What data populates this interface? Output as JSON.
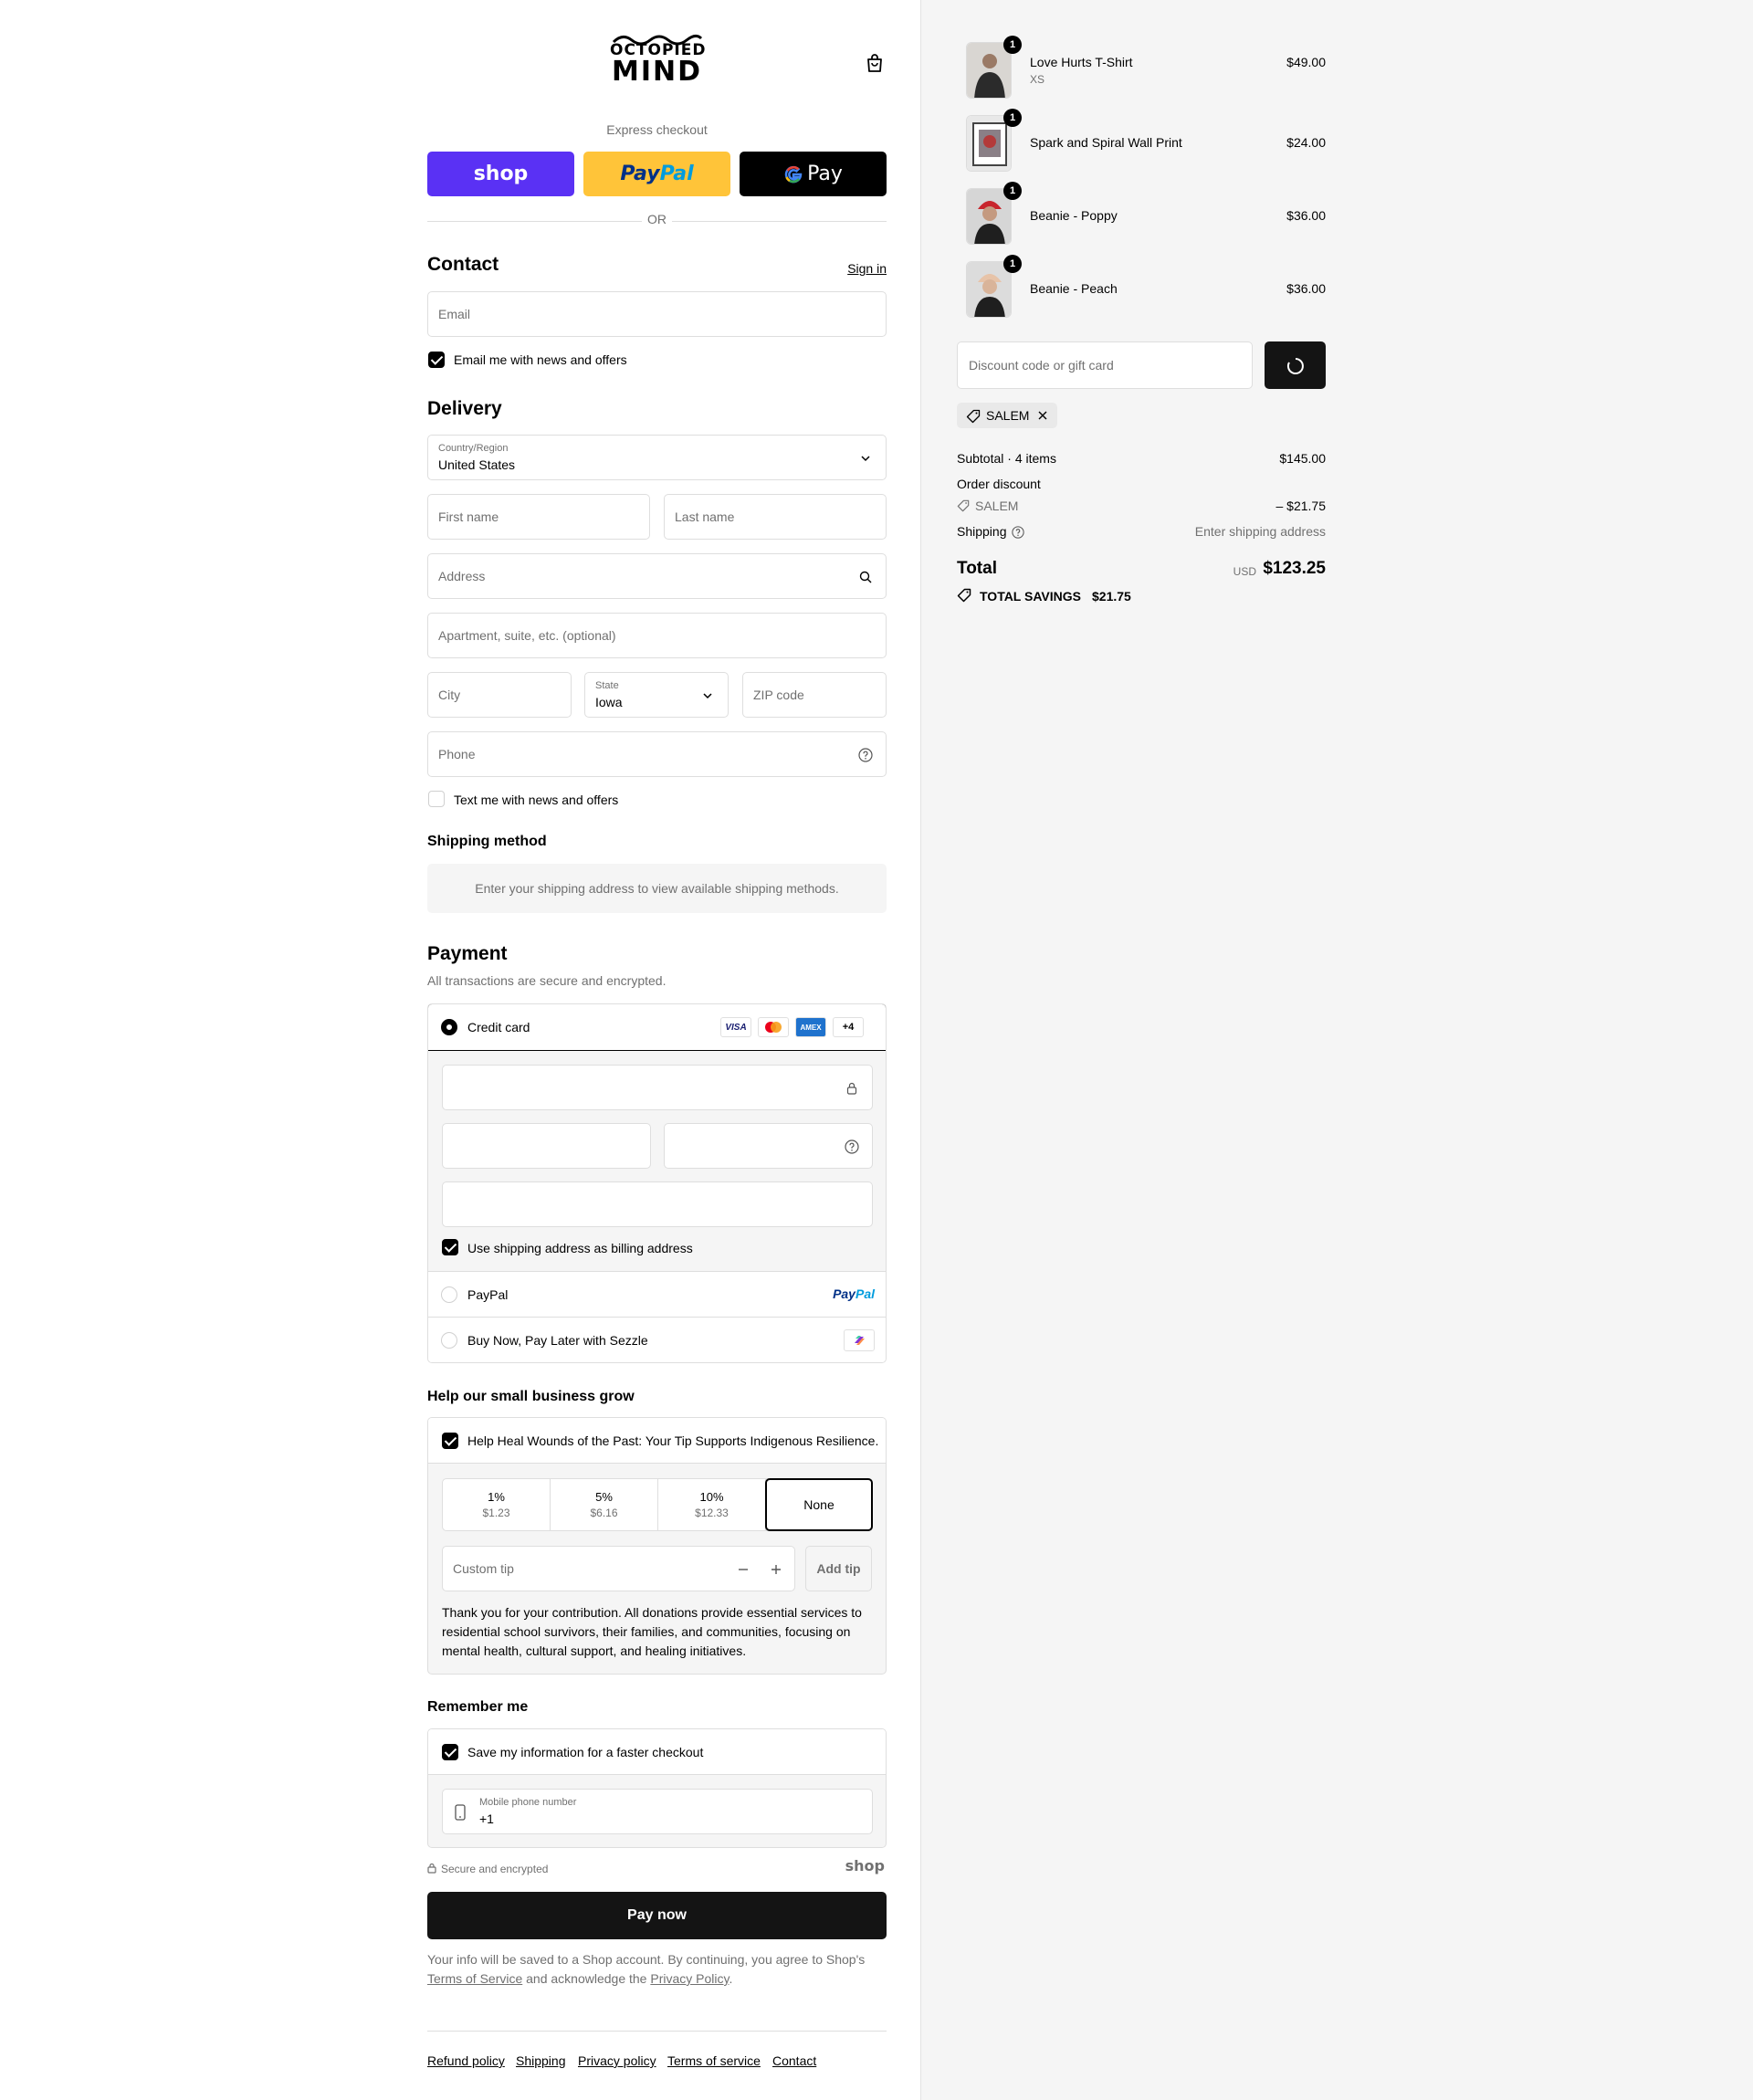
{
  "brand": {
    "line1": "OCTOPIED",
    "line2": "MIND"
  },
  "express": {
    "title": "Express checkout",
    "shop": "shop",
    "paypal_1": "Pay",
    "paypal_2": "Pal",
    "gpay": "Pay",
    "or": "OR"
  },
  "contact": {
    "title": "Contact",
    "sign_in": "Sign in",
    "email_placeholder": "Email",
    "news_label": "Email me with news and offers",
    "news_checked": true
  },
  "delivery": {
    "title": "Delivery",
    "country_label": "Country/Region",
    "country_value": "United States",
    "first_name": "First name",
    "last_name": "Last name",
    "address": "Address",
    "apartment": "Apartment, suite, etc. (optional)",
    "city": "City",
    "state_label": "State",
    "state_value": "Iowa",
    "zip": "ZIP code",
    "phone": "Phone",
    "text_label": "Text me with news and offers",
    "text_checked": false
  },
  "shipping": {
    "title": "Shipping method",
    "note": "Enter your shipping address to view available shipping methods."
  },
  "payment": {
    "title": "Payment",
    "subtitle": "All transactions are secure and encrypted.",
    "credit_card": "Credit card",
    "cards": [
      "VISA",
      "",
      "AMEX",
      "+4"
    ],
    "billing_label": "Use shipping address as billing address",
    "billing_checked": true,
    "paypal": "PayPal",
    "paypal_logo_1": "Pay",
    "paypal_logo_2": "Pal",
    "sezzle": "Buy Now, Pay Later with Sezzle"
  },
  "tip": {
    "title": "Help our small business grow",
    "checkbox_label": "Help Heal Wounds of the Past: Your Tip Supports Indigenous Resilience.",
    "options": [
      {
        "pct": "1%",
        "amt": "$1.23"
      },
      {
        "pct": "5%",
        "amt": "$6.16"
      },
      {
        "pct": "10%",
        "amt": "$12.33"
      },
      {
        "pct": "None",
        "amt": ""
      }
    ],
    "custom_placeholder": "Custom tip",
    "add_label": "Add tip",
    "note": "Thank you for your contribution. All donations provide essential services to residential school survivors, their families, and communities, focusing on mental health, cultural support, and healing initiatives."
  },
  "remember": {
    "title": "Remember me",
    "save_label": "Save my information for a faster checkout",
    "mobile_label": "Mobile phone number",
    "mobile_value": "+1",
    "secure": "Secure and encrypted",
    "shop_logo": "shop"
  },
  "pay_now": "Pay now",
  "legal": {
    "text1": "Your info will be saved to a Shop account. By continuing, you agree to Shop's ",
    "tos": "Terms of Service",
    "text2": " and acknowledge the ",
    "privacy": "Privacy Policy",
    "text3": "."
  },
  "footer": [
    "Refund policy",
    "Shipping",
    "Privacy policy",
    "Terms of service",
    "Contact"
  ],
  "cart": {
    "items": [
      {
        "name": "Love Hurts T-Shirt",
        "variant": "XS",
        "price": "$49.00",
        "qty": "1",
        "color": "#2b2b2b"
      },
      {
        "name": "Spark and Spiral Wall Print",
        "variant": "",
        "price": "$24.00",
        "qty": "1",
        "color": "#8a7f86"
      },
      {
        "name": "Beanie - Poppy",
        "variant": "",
        "price": "$36.00",
        "qty": "1",
        "color": "#c8252c"
      },
      {
        "name": "Beanie - Peach",
        "variant": "",
        "price": "$36.00",
        "qty": "1",
        "color": "#e7c3a8"
      }
    ],
    "discount_placeholder": "Discount code or gift card",
    "applied_code": "SALEM",
    "subtotal_label": "Subtotal · 4 items",
    "subtotal": "$145.00",
    "order_discount_label": "Order discount",
    "discount_code": "SALEM",
    "discount_amount": "– $21.75",
    "shipping_label": "Shipping",
    "shipping_value": "Enter shipping address",
    "total_label": "Total",
    "currency": "USD",
    "total": "$123.25",
    "savings_label": "TOTAL SAVINGS",
    "savings": "$21.75"
  }
}
